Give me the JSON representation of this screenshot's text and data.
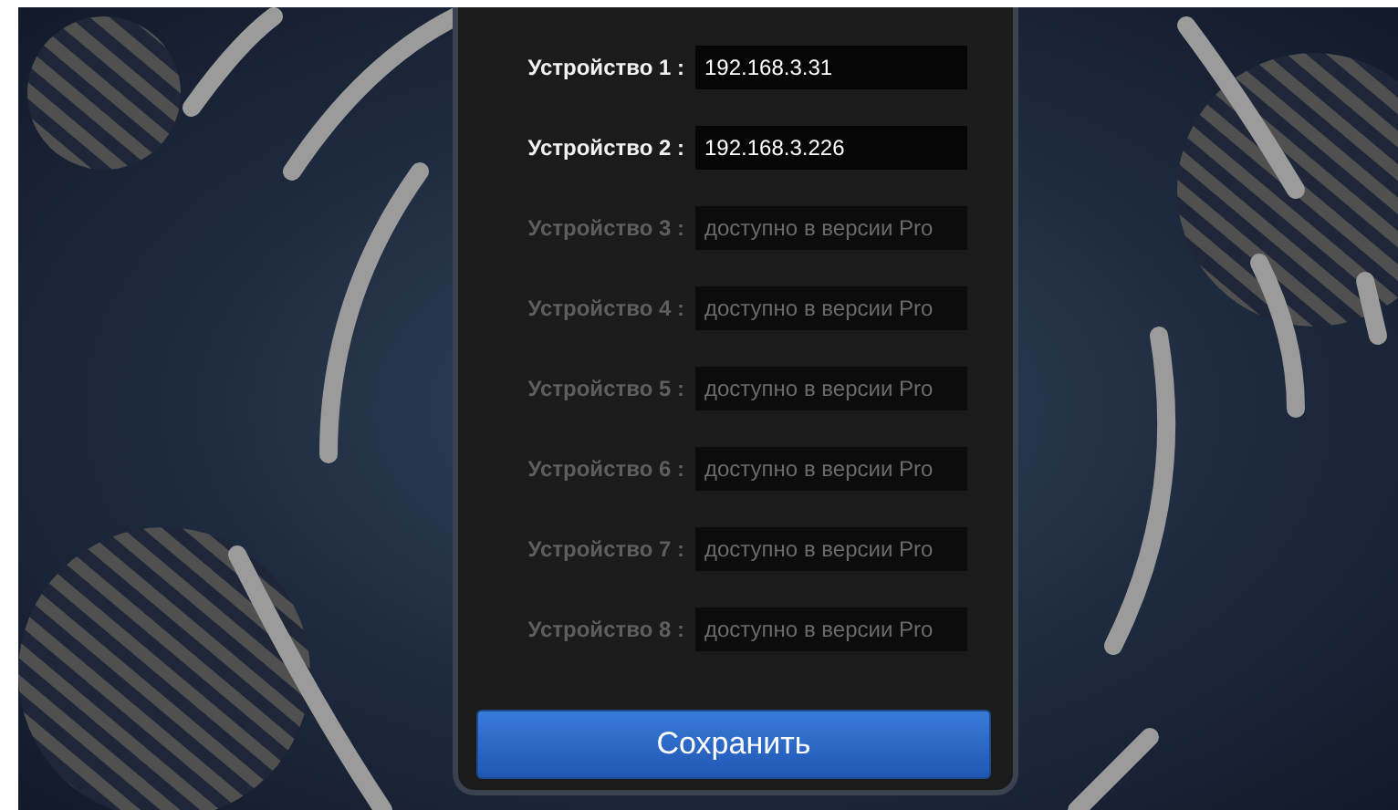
{
  "devices": [
    {
      "label": "Устройство 1 :",
      "value": "192.168.3.31",
      "disabled": false
    },
    {
      "label": "Устройство 2 :",
      "value": "192.168.3.226",
      "disabled": false
    },
    {
      "label": "Устройство 3 :",
      "placeholder": "доступно в версии Pro",
      "disabled": true
    },
    {
      "label": "Устройство 4 :",
      "placeholder": "доступно в версии Pro",
      "disabled": true
    },
    {
      "label": "Устройство 5 :",
      "placeholder": "доступно в версии Pro",
      "disabled": true
    },
    {
      "label": "Устройство 6 :",
      "placeholder": "доступно в версии Pro",
      "disabled": true
    },
    {
      "label": "Устройство 7 :",
      "placeholder": "доступно в версии Pro",
      "disabled": true
    },
    {
      "label": "Устройство 8 :",
      "placeholder": "доступно в версии Pro",
      "disabled": true
    }
  ],
  "save_button": {
    "label": "Сохранить"
  }
}
